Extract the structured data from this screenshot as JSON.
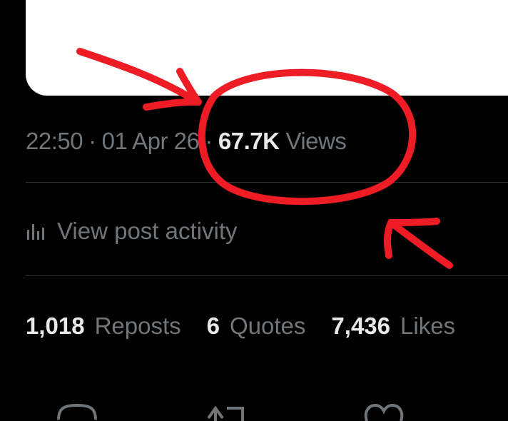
{
  "post": {
    "time": "22:50",
    "date": "01 Apr 26",
    "separator": "·",
    "views_count": "67.7K",
    "views_label": "Views"
  },
  "activity": {
    "label": "View post activity",
    "icon": "bar-chart-icon"
  },
  "stats": [
    {
      "count": "1,018",
      "label": "Reposts"
    },
    {
      "count": "6",
      "label": "Quotes"
    },
    {
      "count": "7,436",
      "label": "Likes"
    }
  ],
  "actions": {
    "icons": [
      "reply-icon",
      "repost-icon",
      "like-icon"
    ]
  },
  "colors": {
    "background": "#000000",
    "text_primary": "#e7e9ea",
    "text_secondary": "#71767b",
    "divider": "#2f3336",
    "annotation": "#ee1c25"
  }
}
